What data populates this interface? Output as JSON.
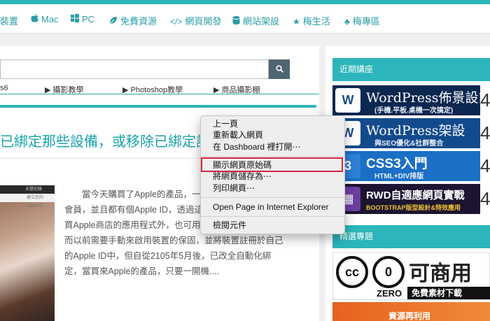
{
  "nav": {
    "items": [
      {
        "label": "裝置",
        "icon": ""
      },
      {
        "label": "Mac",
        "icon": "apple-icon"
      },
      {
        "label": "PC",
        "icon": "windows-icon"
      },
      {
        "label": "免費資源",
        "icon": "leaf-icon"
      },
      {
        "label": "網頁開發",
        "icon": "code-icon"
      },
      {
        "label": "網站架設",
        "icon": "database-icon"
      },
      {
        "label": "梅生活",
        "icon": "star-icon"
      },
      {
        "label": "梅專區",
        "icon": "club-icon"
      }
    ],
    "accent": "#2cb5ba"
  },
  "search": {
    "value": "",
    "button_icon": "search-icon"
  },
  "tags": [
    {
      "label": "s6"
    },
    {
      "label": "▶ 攝影教學"
    },
    {
      "label": "▶ Photoshop教學"
    },
    {
      "label": "▶ 商品攝影棚"
    }
  ],
  "article": {
    "title": "已綁定那些設備，或移除已綁定設",
    "thumb_top": "未登記錄",
    "thumb_sub": "建立您的 Apple ID",
    "lines": [
      "當今天購買了Apple的產品，一",
      "會員，並且都有個Apple ID，透過這",
      "買Apple商店的應用程式外，也可用",
      "而以前需要手動來啟用裝置的保固，並將裝置註冊於自己",
      "的Apple ID中，但自從2105年5月後，已改全自動化綁",
      "定，當買來Apple的產品，只要一開機...."
    ]
  },
  "sidebar": {
    "recent_title": "近期講座",
    "banners": [
      {
        "logo": "W",
        "main": "WordPress佈景設計",
        "sub": "(手機.平板.桌機一次搞定)",
        "num": "4"
      },
      {
        "logo": "W",
        "main": "WordPress架設",
        "sub": "與SEO優化&社群整合",
        "num": "4"
      },
      {
        "logo": "3",
        "main": "CSS3入門",
        "sub": "HTML+DIV排版",
        "num": "4"
      },
      {
        "logo": "▦",
        "main": "RWD自適應網頁實戰",
        "sub": "BOOTSTRAP版型設計&特效應用",
        "num": "4"
      }
    ],
    "featured_title": "精選專題",
    "cc": {
      "cc": "cc",
      "zero_symbol": "0",
      "big": "可商用",
      "zero": "ZERO",
      "free": "免費素材下載"
    },
    "reuse": "資源再利用"
  },
  "context_menu": {
    "items": [
      "上一頁",
      "重新載入網頁",
      "在 Dashboard 裡打開⋯",
      "顯示網頁原始碼",
      "將網頁儲存為⋯",
      "列印網頁⋯",
      "Open Page in Internet Explorer",
      "檢閱元件"
    ],
    "highlight_color": "#d4263f"
  }
}
